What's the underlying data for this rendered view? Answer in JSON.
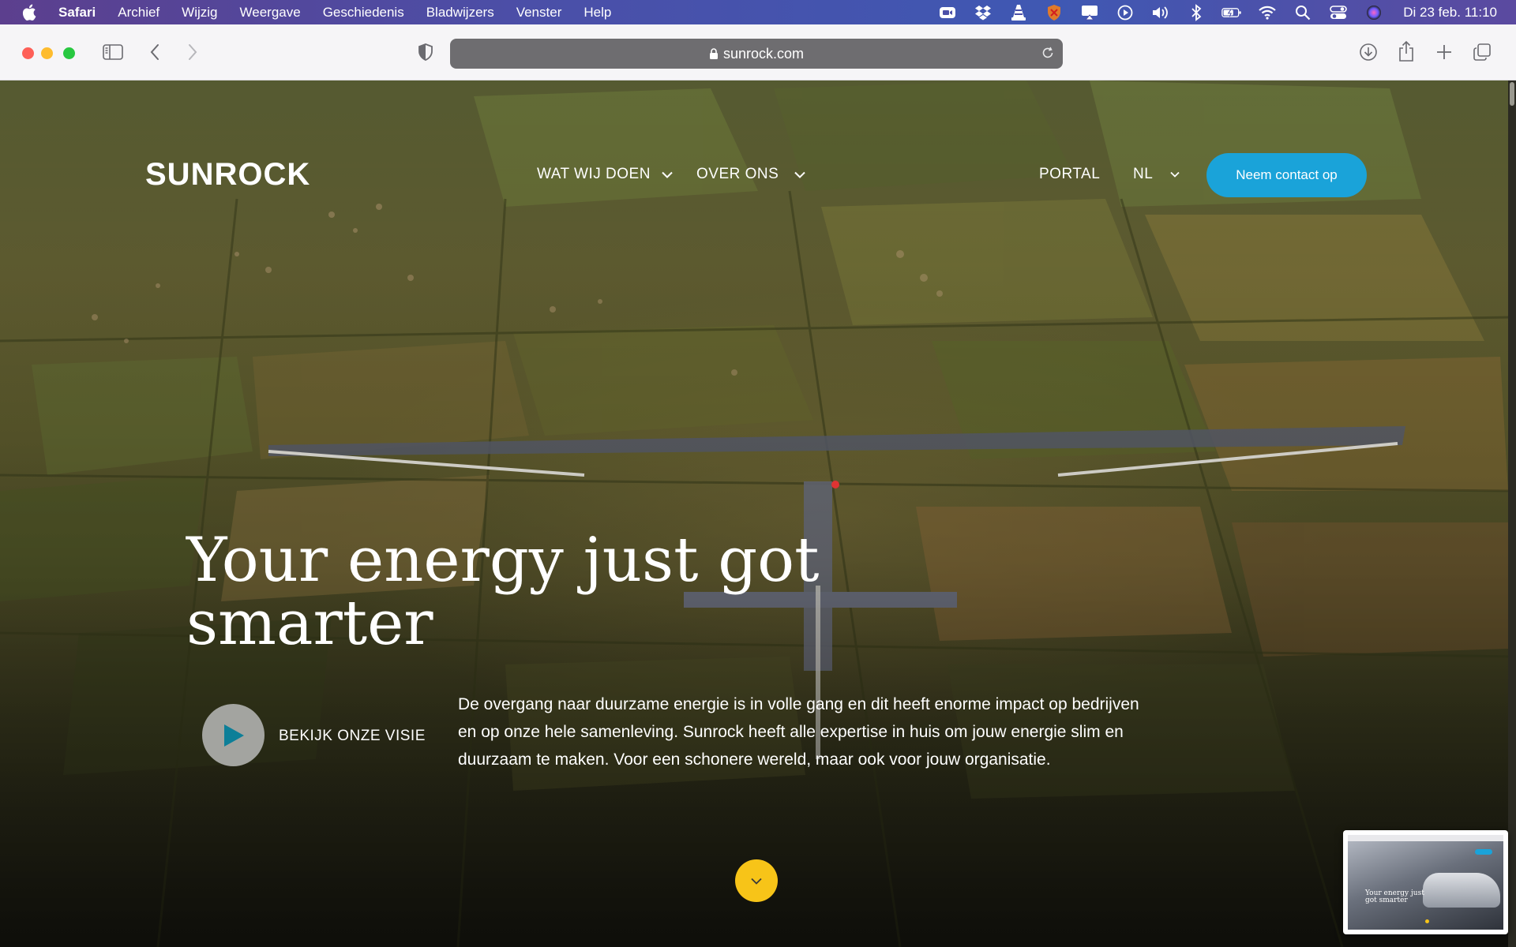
{
  "menubar": {
    "app_name": "Safari",
    "items": [
      "Archief",
      "Wijzig",
      "Weergave",
      "Geschiedenis",
      "Bladwijzers",
      "Venster",
      "Help"
    ],
    "clock": "Di 23 feb.  11:10",
    "status_icons": [
      "zoom-icon",
      "dropbox-icon",
      "vlc-icon",
      "shield-icon",
      "airplay-icon",
      "play-icon",
      "volume-icon",
      "bluetooth-icon",
      "battery-icon",
      "wifi-icon",
      "search-icon",
      "control-center-icon",
      "siri-icon"
    ]
  },
  "browser": {
    "url": "sunrock.com"
  },
  "site": {
    "logo": "SUNROCK",
    "nav": {
      "what_we_do": "WAT WIJ DOEN",
      "about_us": "OVER ONS",
      "portal": "PORTAL",
      "language": "NL"
    },
    "contact_button": "Neem contact op",
    "headline": "Your energy just got smarter",
    "video_label": "BEKIJK ONZE VISIE",
    "intro": "De overgang naar duurzame energie is in volle gang en dit heeft enorme impact op bedrijven en op onze hele samenleving. Sunrock heeft alle expertise in huis om jouw energie slim en duurzaam te maken. Voor een schonere wereld, maar ook voor jouw organisatie.",
    "thumbnail_headline": "Your energy just got smarter",
    "colors": {
      "accent_blue": "#1aa3d9",
      "accent_yellow": "#f7c418"
    }
  }
}
